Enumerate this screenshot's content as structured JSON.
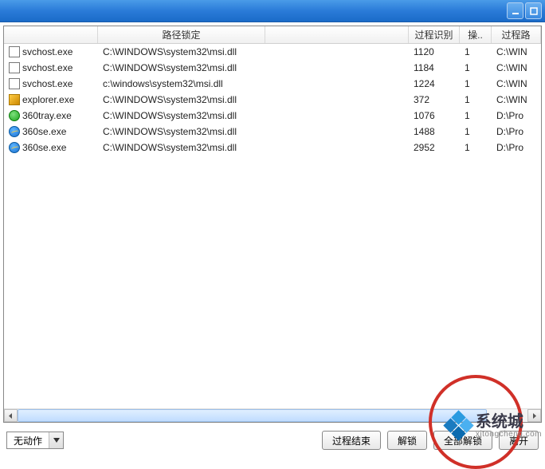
{
  "window": {
    "minimize_label": "Minimize",
    "maximize_label": "Maximize"
  },
  "columns": {
    "name": "",
    "path": "路径锁定",
    "pid": "过程识别",
    "op": "操..",
    "ppath": "过程路"
  },
  "rows": [
    {
      "icon": "app",
      "name": "svchost.exe",
      "path": "C:\\WINDOWS\\system32\\msi.dll",
      "pid": "1120",
      "op": "1",
      "ppath": "C:\\WIN"
    },
    {
      "icon": "app",
      "name": "svchost.exe",
      "path": "C:\\WINDOWS\\system32\\msi.dll",
      "pid": "1184",
      "op": "1",
      "ppath": "C:\\WIN"
    },
    {
      "icon": "app",
      "name": "svchost.exe",
      "path": "c:\\windows\\system32\\msi.dll",
      "pid": "1224",
      "op": "1",
      "ppath": "C:\\WIN"
    },
    {
      "icon": "exp",
      "name": "explorer.exe",
      "path": "C:\\WINDOWS\\system32\\msi.dll",
      "pid": "372",
      "op": "1",
      "ppath": "C:\\WIN"
    },
    {
      "icon": "360",
      "name": "360tray.exe",
      "path": "C:\\WINDOWS\\system32\\msi.dll",
      "pid": "1076",
      "op": "1",
      "ppath": "D:\\Pro"
    },
    {
      "icon": "ie",
      "name": "360se.exe",
      "path": "C:\\WINDOWS\\system32\\msi.dll",
      "pid": "1488",
      "op": "1",
      "ppath": "D:\\Pro"
    },
    {
      "icon": "ie",
      "name": "360se.exe",
      "path": "C:\\WINDOWS\\system32\\msi.dll",
      "pid": "2952",
      "op": "1",
      "ppath": "D:\\Pro"
    }
  ],
  "action_select": {
    "value": "无动作"
  },
  "buttons": {
    "end_process": "过程结束",
    "unlock": "解锁",
    "unlock_all": "全部解锁",
    "leave": "离开"
  },
  "watermark": {
    "title": "系统城",
    "sub": "xitongcheng.com"
  }
}
